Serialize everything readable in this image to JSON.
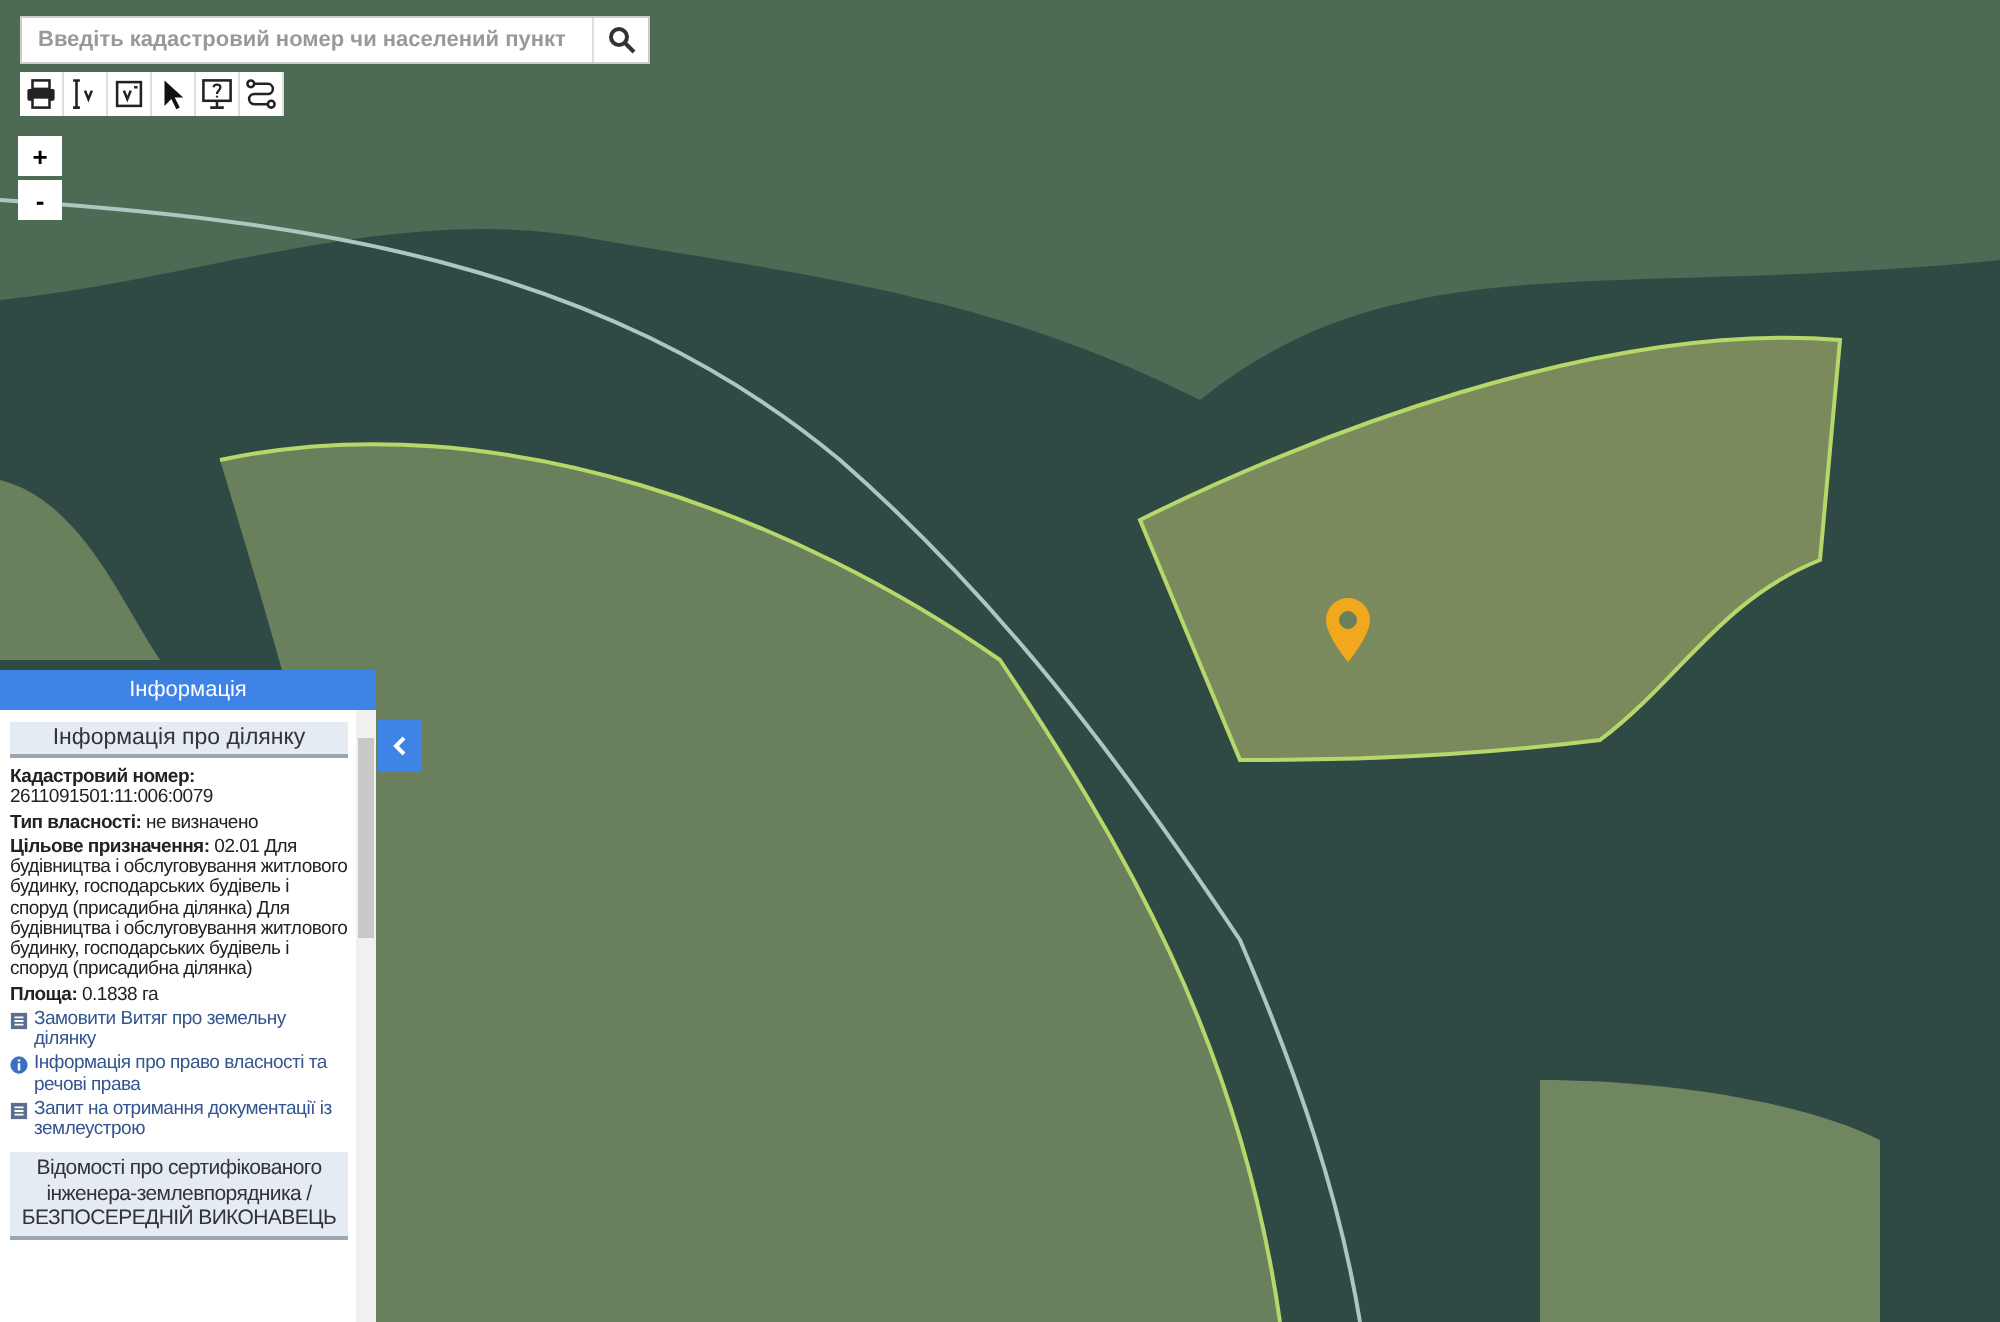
{
  "search": {
    "placeholder": "Введіть кадастровий номер чи населений пункт"
  },
  "zoom": [
    "+",
    "-"
  ],
  "panel": {
    "title": "Інформація",
    "section_title": "Інформація про ділянку",
    "fields": [
      "**Кадастровий номер:** 2611091501:11:006:0079",
      "**Тип власності:** не визначено",
      "**Цільове призначення:** 02.01 Для будівництва і обслуговування житлового будинку, господарських будівель і споруд (присадибна ділянка) Для будівництва і обслуговування житлового будинку, господарських будівель і споруд (присадибна ділянка)",
      "**Площа:** 0.1838 га"
    ],
    "links": [
      {
        "kind": "document",
        "label": "Замовити Витяг про земельну ділянку"
      },
      {
        "kind": "info",
        "label": "Інформація про право власності та речові права"
      },
      {
        "kind": "document",
        "label": "Запит на отримання документації із землеустрою"
      }
    ],
    "engineer_title": "Відомості про сертифікованого інженера-землевпорядника / БЕЗПОСЕРЕДНІЙ ВИКОНАВЕЦЬ"
  }
}
